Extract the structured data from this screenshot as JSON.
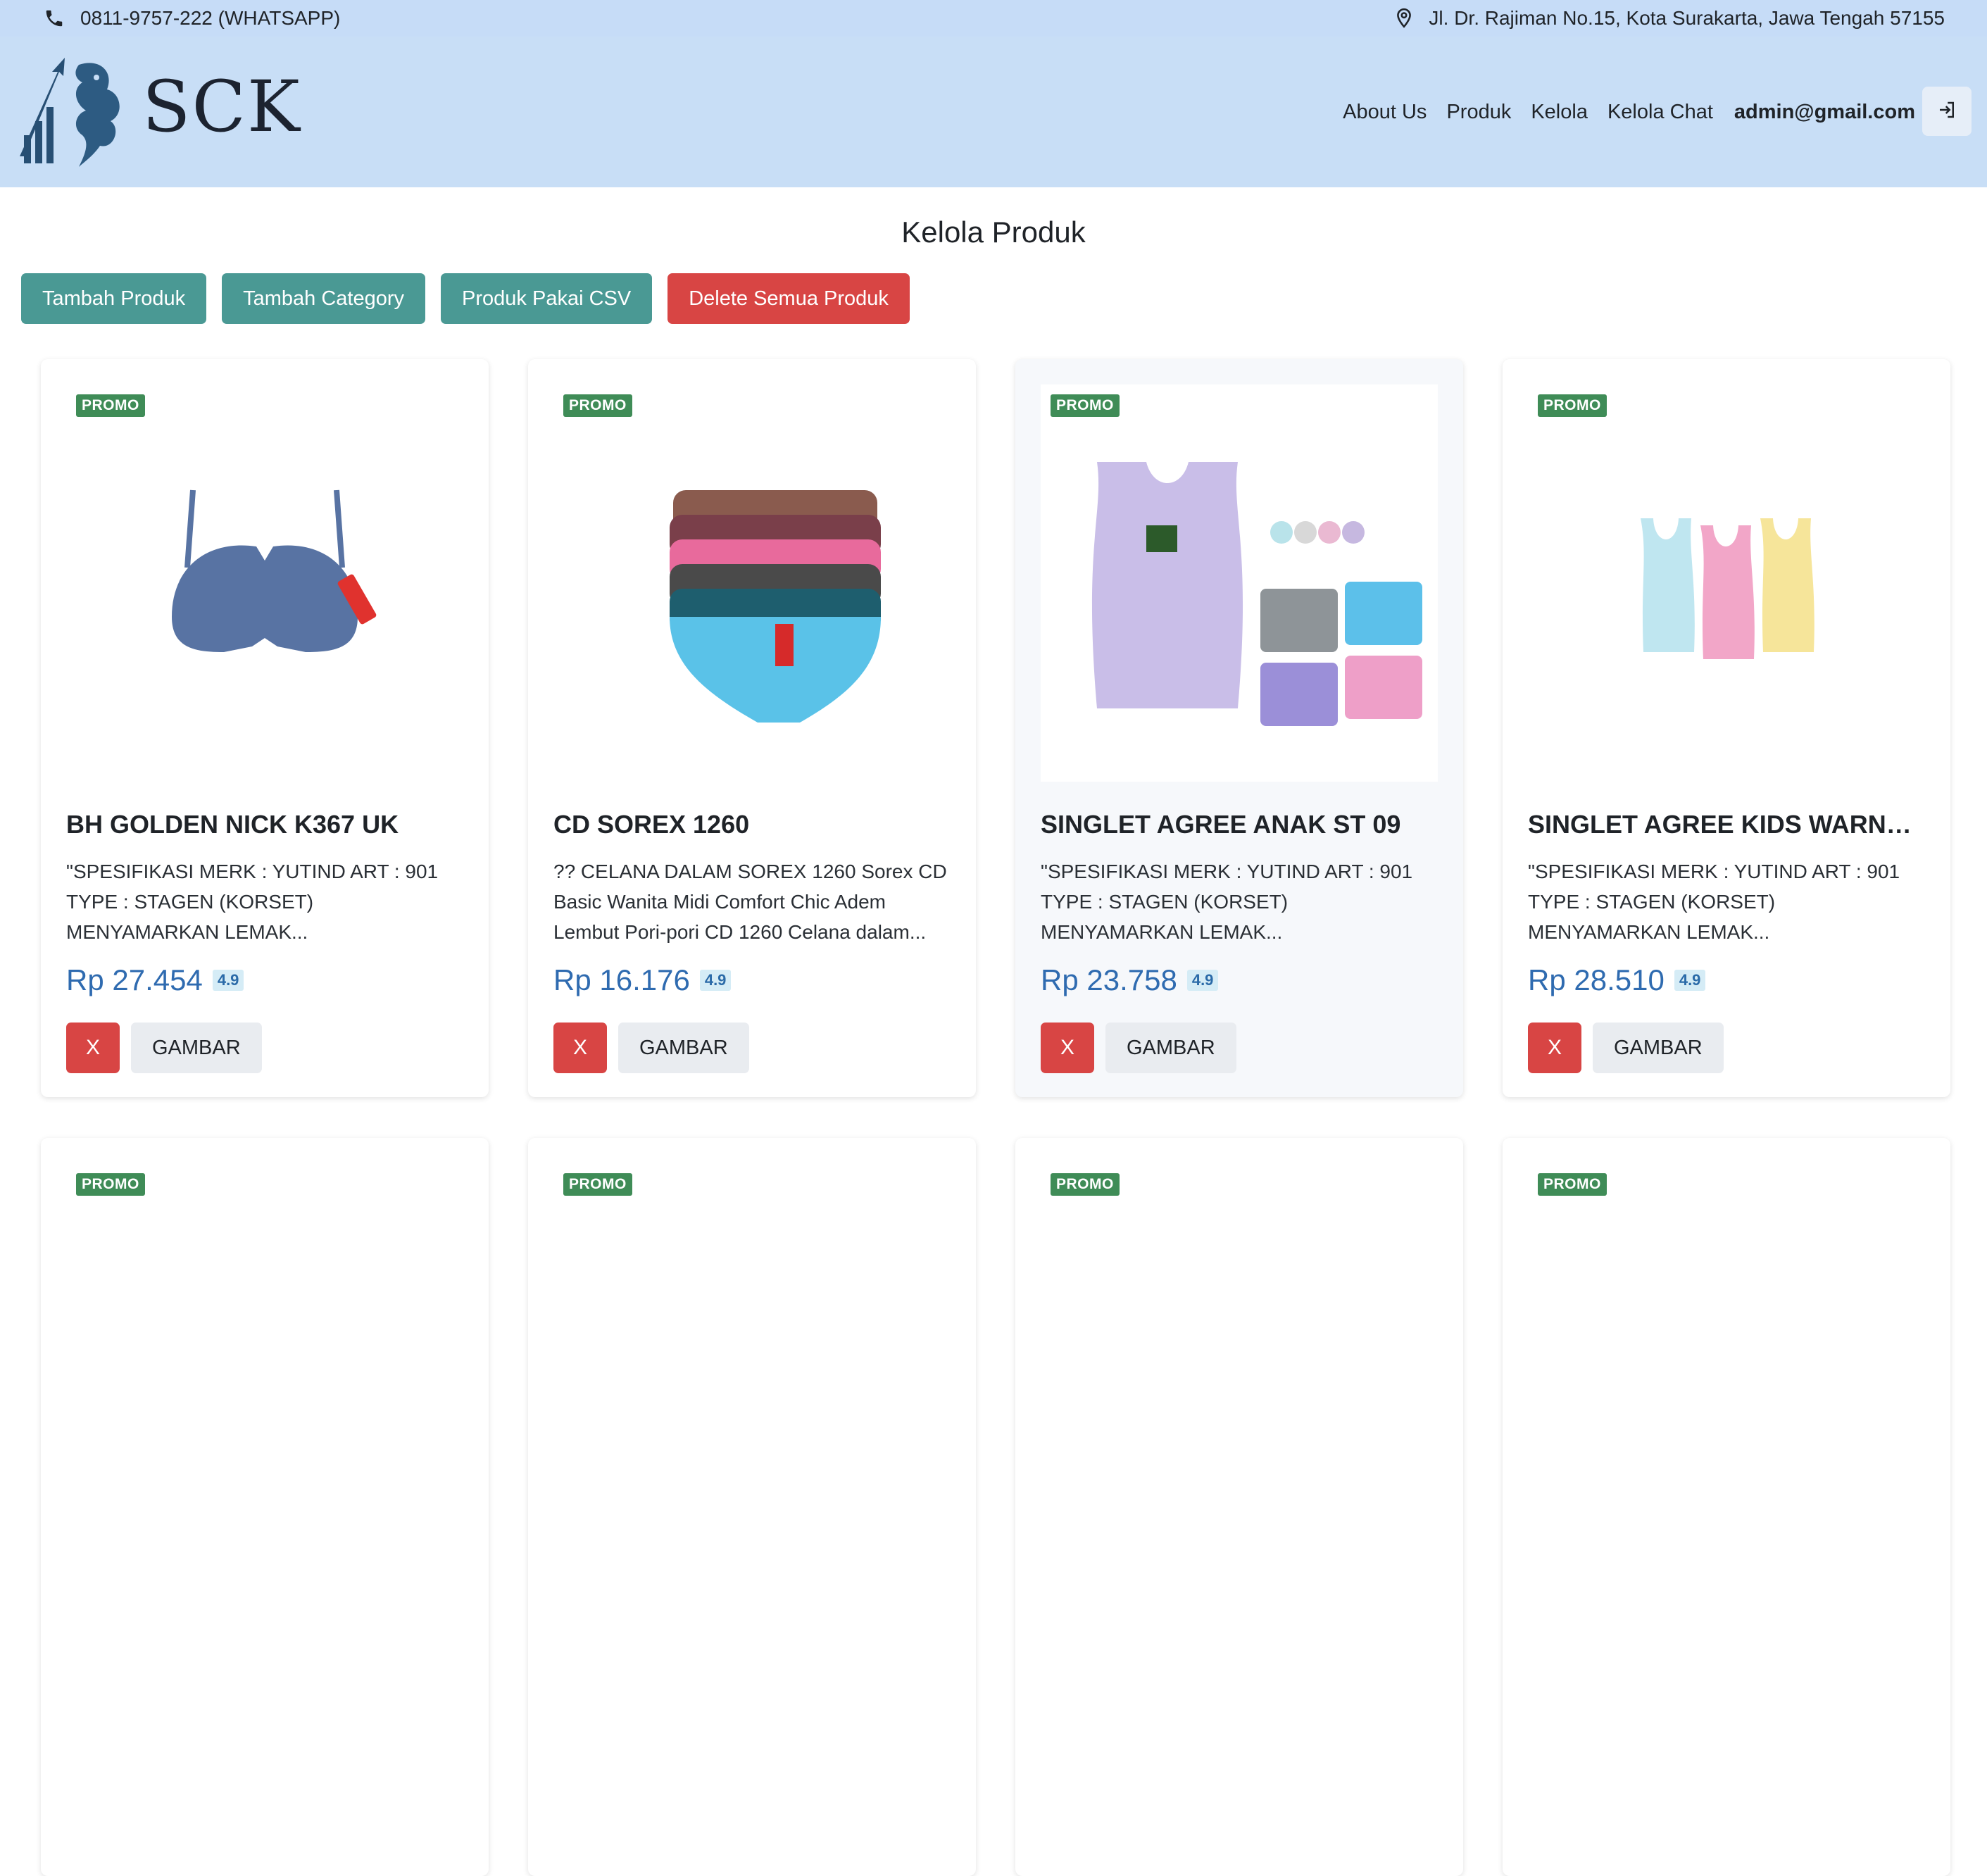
{
  "contact": {
    "phone": "0811-9757-222 (WHATSAPP)",
    "address": "Jl. Dr. Rajiman No.15, Kota Surakarta, Jawa Tengah 57155"
  },
  "brand": {
    "name": "SCK"
  },
  "nav": {
    "items": [
      "About Us",
      "Produk",
      "Kelola",
      "Kelola Chat"
    ],
    "email": "admin@gmail.com"
  },
  "page": {
    "title": "Kelola Produk"
  },
  "actions": {
    "add_product": "Tambah Produk",
    "add_category": "Tambah Category",
    "csv_product": "Produk Pakai CSV",
    "delete_all": "Delete Semua Produk"
  },
  "products": [
    {
      "badge": "PROMO",
      "name": "BH GOLDEN NICK K367 UK",
      "description": "\"SPESIFIKASI MERK : YUTIND ART : 901 TYPE : STAGEN (KORSET) MENYAMARKAN LEMAK...",
      "price": "Rp 27.454",
      "rating": "4.9",
      "delete_label": "X",
      "image_label": "GAMBAR"
    },
    {
      "badge": "PROMO",
      "name": "CD SOREX 1260",
      "description": "?? CELANA DALAM SOREX 1260 Sorex CD Basic Wanita Midi Comfort Chic Adem Lembut Pori-pori CD 1260 Celana dalam...",
      "price": "Rp 16.176",
      "rating": "4.9",
      "delete_label": "X",
      "image_label": "GAMBAR"
    },
    {
      "badge": "PROMO",
      "name": "SINGLET AGREE ANAK ST 09",
      "description": "\"SPESIFIKASI MERK : YUTIND ART : 901 TYPE : STAGEN (KORSET) MENYAMARKAN LEMAK...",
      "price": "Rp 23.758",
      "rating": "4.9",
      "delete_label": "X",
      "image_label": "GAMBAR"
    },
    {
      "badge": "PROMO",
      "name": "SINGLET AGREE KIDS WARNA ...",
      "description": "\"SPESIFIKASI MERK : YUTIND ART : 901 TYPE : STAGEN (KORSET) MENYAMARKAN LEMAK...",
      "price": "Rp 28.510",
      "rating": "4.9",
      "delete_label": "X",
      "image_label": "GAMBAR"
    }
  ],
  "next_row_badges": [
    "PROMO",
    "PROMO",
    "PROMO",
    "PROMO"
  ]
}
